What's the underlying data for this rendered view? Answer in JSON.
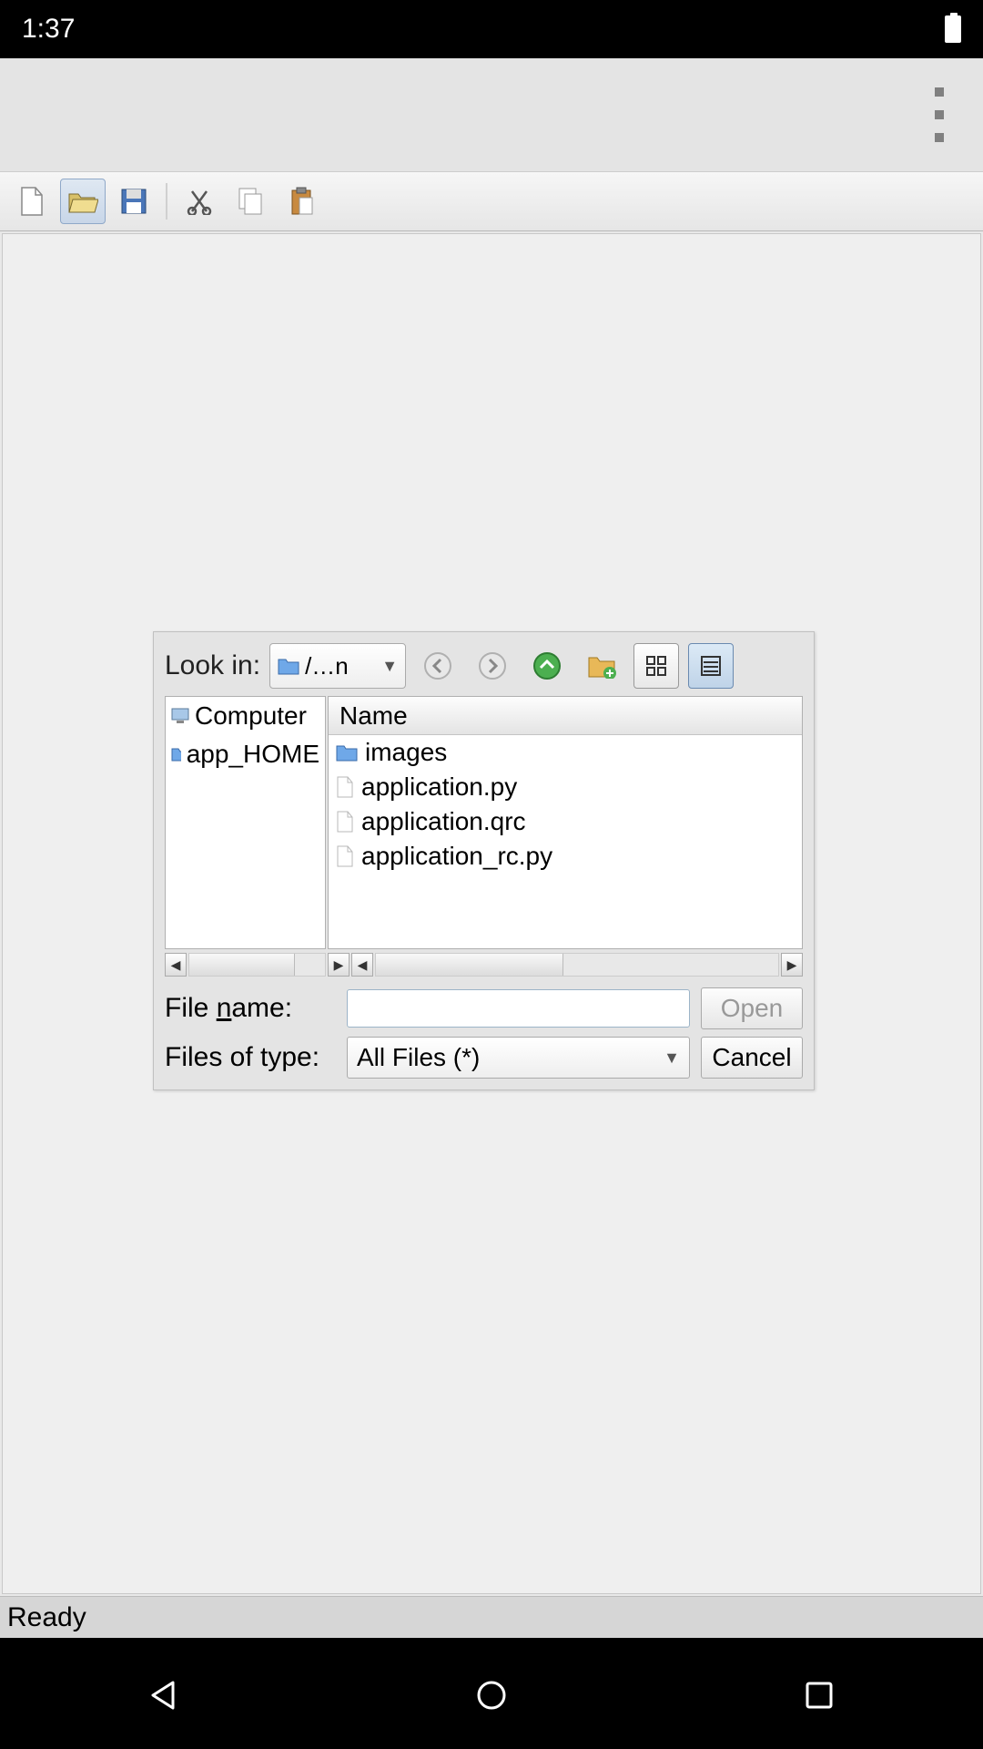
{
  "status_bar": {
    "time": "1:37"
  },
  "toolbar": {
    "buttons": [
      "new",
      "open",
      "save",
      "cut",
      "copy",
      "paste"
    ]
  },
  "dialog": {
    "look_in_label": "Look in:",
    "look_in_value": "/…n",
    "side_items": [
      {
        "label": "Computer",
        "icon": "computer"
      },
      {
        "label": "app_HOME",
        "icon": "folder"
      }
    ],
    "column_header": "Name",
    "files": [
      {
        "label": "images",
        "icon": "folder"
      },
      {
        "label": "application.py",
        "icon": "file"
      },
      {
        "label": "application.qrc",
        "icon": "file"
      },
      {
        "label": "application_rc.py",
        "icon": "file"
      }
    ],
    "file_name_label": "File name:",
    "file_name_value": "",
    "files_of_type_label": "Files of type:",
    "files_of_type_value": "All Files (*)",
    "open_label": "Open",
    "cancel_label": "Cancel"
  },
  "status_text": "Ready"
}
